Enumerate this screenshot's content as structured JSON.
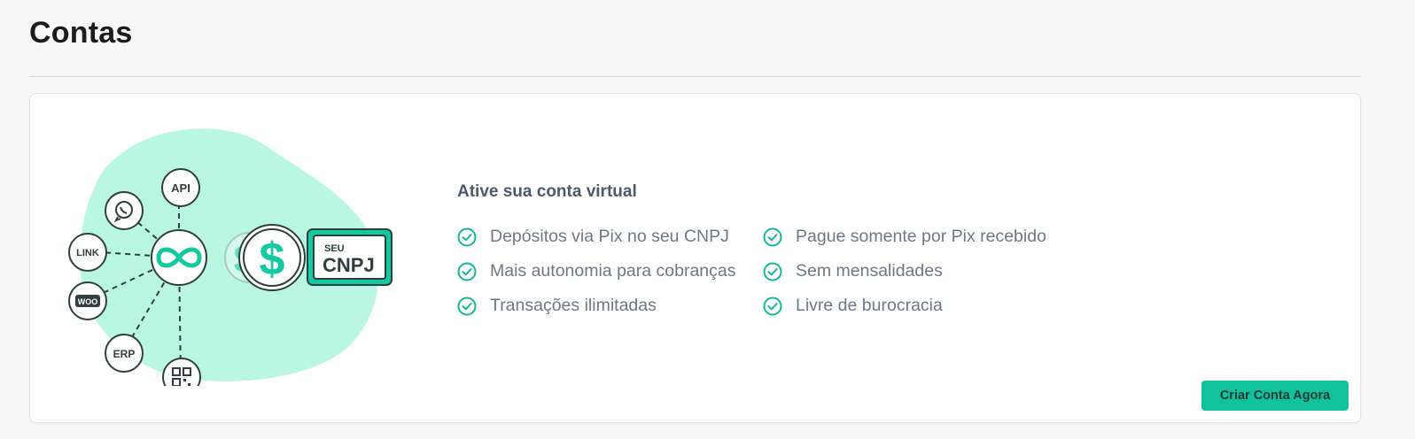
{
  "page": {
    "title": "Contas"
  },
  "illustration": {
    "nodes": {
      "api": "API",
      "link": "LINK",
      "woo": "WOO",
      "erp": "ERP"
    },
    "badge_top": "SEU",
    "badge_bottom": "CNPJ",
    "accent_color": "#13c9a0",
    "blob_color": "#b9f7e2"
  },
  "card": {
    "heading": "Ative sua conta virtual",
    "features": [
      "Depósitos via Pix no seu CNPJ",
      "Pague somente por Pix recebido",
      "Mais autonomia para cobranças",
      "Sem mensalidades",
      "Transações ilimitadas",
      "Livre de burocracia"
    ],
    "cta_label": "Criar Conta Agora",
    "check_color": "#12b896",
    "button_color": "#12c19e"
  }
}
